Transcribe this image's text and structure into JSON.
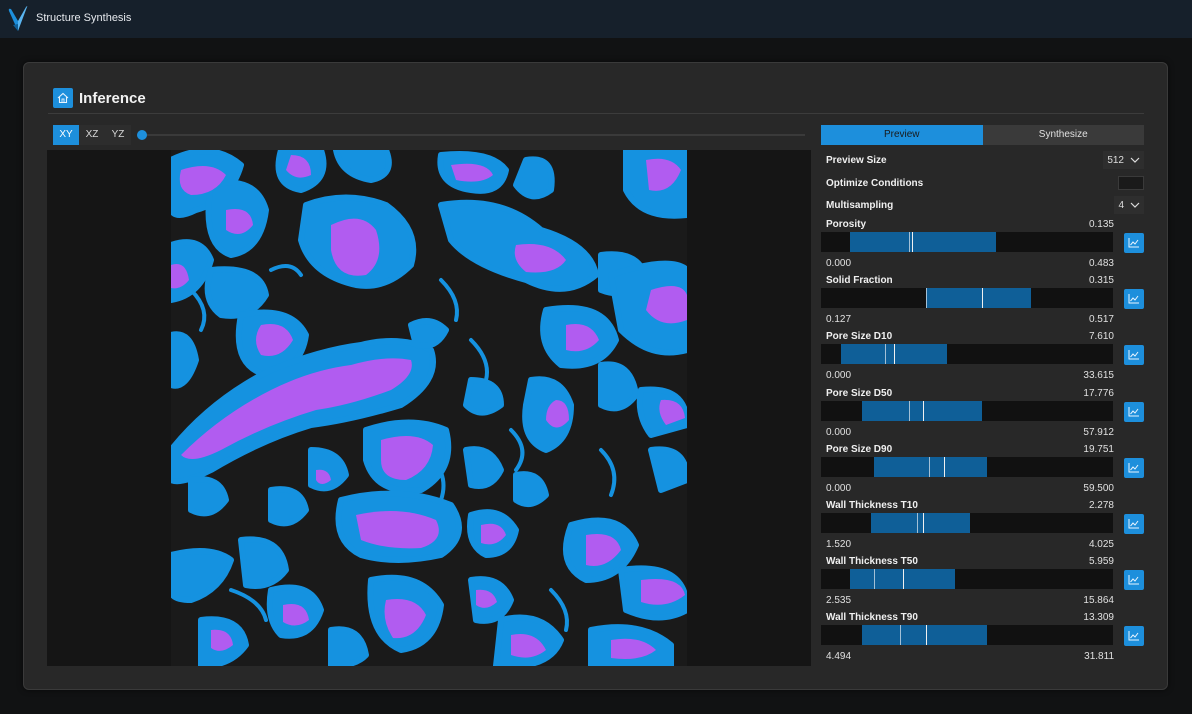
{
  "app": {
    "title": "Structure Synthesis"
  },
  "card": {
    "title": "Inference"
  },
  "views": {
    "tabs": [
      "XY",
      "XZ",
      "YZ"
    ],
    "active": "XY",
    "slice_fraction": 0.0
  },
  "side": {
    "tabs": [
      "Preview",
      "Synthesize"
    ],
    "active": "Preview",
    "preview_size": {
      "label": "Preview Size",
      "value": "512"
    },
    "optimize": {
      "label": "Optimize Conditions",
      "enabled": false
    },
    "multisampling": {
      "label": "Multisampling",
      "value": "4"
    }
  },
  "properties": [
    {
      "name": "Porosity",
      "value": "0.135",
      "min": "0.000",
      "max": "0.483",
      "range": [
        0.1,
        0.6
      ],
      "marks": [
        0.3,
        0.31
      ]
    },
    {
      "name": "Solid Fraction",
      "value": "0.315",
      "min": "0.127",
      "max": "0.517",
      "range": [
        0.36,
        0.72
      ],
      "marks": [
        0.36,
        0.55
      ]
    },
    {
      "name": "Pore Size D10",
      "value": "7.610",
      "min": "0.000",
      "max": "33.615",
      "range": [
        0.07,
        0.43
      ],
      "marks": [
        0.22,
        0.25
      ]
    },
    {
      "name": "Pore Size D50",
      "value": "17.776",
      "min": "0.000",
      "max": "57.912",
      "range": [
        0.14,
        0.55
      ],
      "marks": [
        0.3,
        0.35
      ]
    },
    {
      "name": "Pore Size D90",
      "value": "19.751",
      "min": "0.000",
      "max": "59.500",
      "range": [
        0.18,
        0.57
      ],
      "marks": [
        0.37,
        0.42
      ]
    },
    {
      "name": "Wall Thickness T10",
      "value": "2.278",
      "min": "1.520",
      "max": "4.025",
      "range": [
        0.17,
        0.51
      ],
      "marks": [
        0.33,
        0.35
      ]
    },
    {
      "name": "Wall Thickness T50",
      "value": "5.959",
      "min": "2.535",
      "max": "15.864",
      "range": [
        0.1,
        0.46
      ],
      "marks": [
        0.18,
        0.28
      ]
    },
    {
      "name": "Wall Thickness T90",
      "value": "13.309",
      "min": "4.494",
      "max": "31.811",
      "range": [
        0.14,
        0.57
      ],
      "marks": [
        0.27,
        0.36
      ]
    }
  ],
  "colors": {
    "accent": "#1d8fdc",
    "phase_pore": "#b15cf0",
    "phase_mid": "#1592e0",
    "phase_solid": "#1a1a1a"
  },
  "icons": {
    "logo": "butterfly-logo",
    "home": "home-icon",
    "plot": "histogram-icon",
    "dropdown": "chevron-down-icon"
  }
}
